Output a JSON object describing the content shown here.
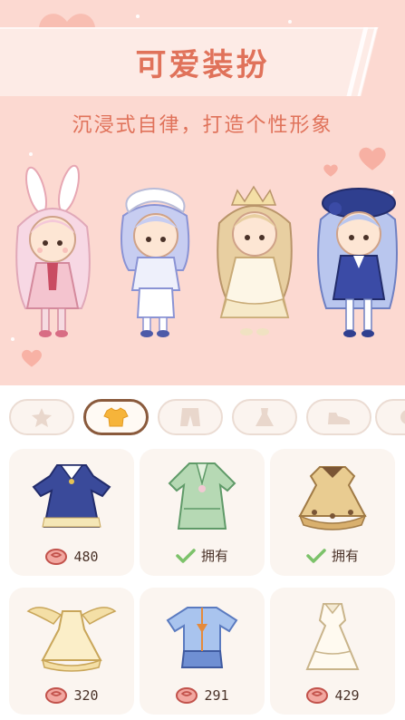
{
  "banner": {
    "title": "可爱装扮",
    "subtitle": "沉浸式自律，打造个性形象",
    "characters": [
      "bunny-girl-character",
      "blue-cap-boy-character",
      "angel-girl-character",
      "navy-beret-girl-character"
    ]
  },
  "tabs": [
    {
      "name": "tab-hair",
      "icon": "hair-star-icon",
      "active": false
    },
    {
      "name": "tab-top",
      "icon": "shirt-icon",
      "active": true
    },
    {
      "name": "tab-pants",
      "icon": "pants-icon",
      "active": false
    },
    {
      "name": "tab-dress",
      "icon": "dress-icon",
      "active": false
    },
    {
      "name": "tab-shoes",
      "icon": "shoe-icon",
      "active": false
    },
    {
      "name": "tab-more",
      "icon": "accessory-icon",
      "active": false
    }
  ],
  "items": [
    {
      "outfit": "navy-sailor-dress",
      "state": "price",
      "price": "480"
    },
    {
      "outfit": "green-hanfu-dress",
      "state": "owned",
      "owned_label": "拥有"
    },
    {
      "outfit": "brown-tea-dress",
      "state": "owned",
      "owned_label": "拥有"
    },
    {
      "outfit": "gold-wing-dress",
      "state": "price",
      "price": "320"
    },
    {
      "outfit": "blue-cute-outfit",
      "state": "price",
      "price": "291"
    },
    {
      "outfit": "white-gown",
      "state": "price",
      "price": "429"
    }
  ],
  "colors": {
    "accent": "#e0725a",
    "banner_bg": "#fcd9d1",
    "card_bg": "#fbf5f0",
    "tab_active_border": "#8a5a3c",
    "check_green": "#7cc26a"
  }
}
